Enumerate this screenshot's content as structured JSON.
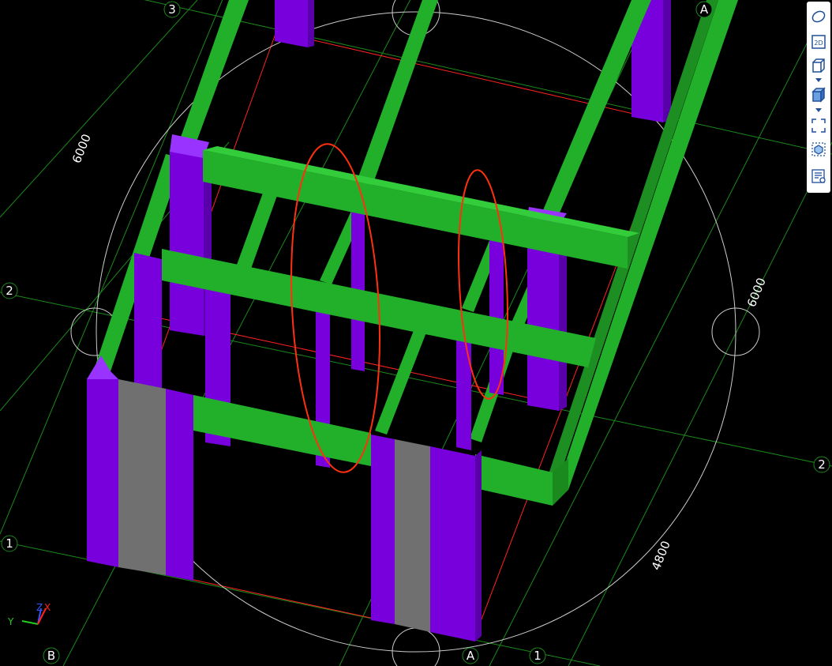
{
  "grid_labels": {
    "top_3": "3",
    "top_a": "A",
    "left_2": "2",
    "right_2": "2",
    "left_1": "1",
    "bottom_b": "B",
    "bottom_a": "A",
    "bottom_1": "1"
  },
  "dimensions": {
    "left": "6000",
    "right": "6000",
    "bottom_right": "4800"
  },
  "axis": {
    "x": "X",
    "y": "Y",
    "z": "Z"
  },
  "toolbar": {
    "items": [
      {
        "name": "orbit",
        "label": ""
      },
      {
        "name": "view-2d",
        "label": "2D"
      },
      {
        "name": "view-3d",
        "label": ""
      },
      {
        "name": "shaded-view",
        "label": ""
      },
      {
        "name": "zoom-extents",
        "label": ""
      },
      {
        "name": "section-box",
        "label": ""
      },
      {
        "name": "properties",
        "label": ""
      }
    ]
  },
  "colors": {
    "background": "#000000",
    "beam": "#22b02a",
    "column": "#7700dd",
    "wall": "#707070",
    "grid_line": "#1a8a1a",
    "outline": "#ff2020",
    "highlight": "#ff3010",
    "nav_circle": "#cccccc",
    "toolbar_icon": "#1f4f99"
  }
}
